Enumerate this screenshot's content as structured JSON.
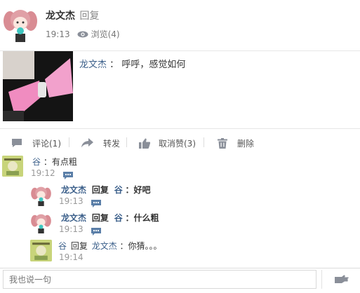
{
  "post": {
    "author": "龙文杰",
    "action": "回复",
    "time": "19:13",
    "views_label": "浏览(4)"
  },
  "quote": {
    "author": "龙文杰",
    "colon": "：",
    "text": "呼呼，感觉如何"
  },
  "toolbar": {
    "comment_label": "评论(1)",
    "forward_label": "转发",
    "unlike_label": "取消赞(3)",
    "delete_label": "删除"
  },
  "comments": [
    {
      "author": "谷",
      "text": "：有点粗",
      "time": "19:12"
    }
  ],
  "replies": [
    {
      "author": "龙文杰",
      "reply_word": "回复",
      "target": "谷",
      "text": "：好吧",
      "time": "19:13"
    },
    {
      "author": "龙文杰",
      "reply_word": "回复",
      "target": "谷",
      "text": "：什么粗",
      "time": "19:13"
    },
    {
      "author": "谷",
      "reply_word": "回复",
      "target": "龙文杰",
      "text": "：你猜。。。",
      "time": "19:14"
    }
  ],
  "input": {
    "placeholder": "我也说一句"
  },
  "icons": {
    "views": "eye-icon",
    "comment": "comment-icon",
    "forward": "forward-arrow-icon",
    "unlike": "thumbs-up-icon",
    "delete": "trash-icon",
    "reply": "speech-bubble-icon",
    "send": "send-hand-icon"
  },
  "colors": {
    "link": "#3b5f8a",
    "muted": "#999999",
    "icon": "#8a8f99"
  }
}
